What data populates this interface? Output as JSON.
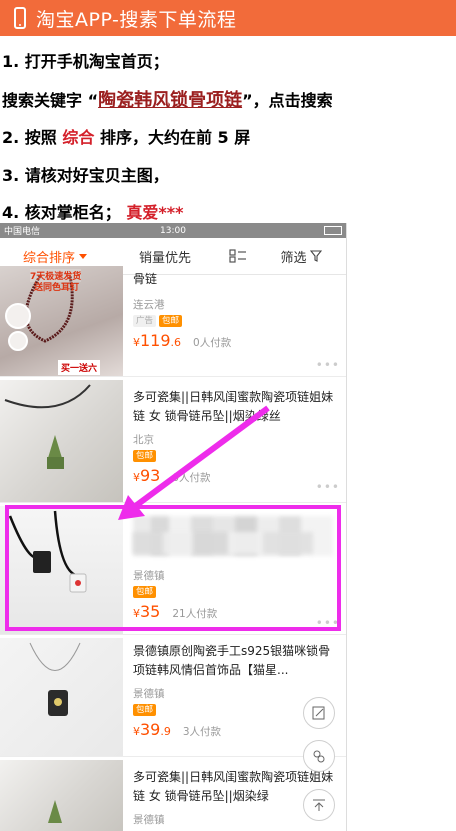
{
  "header": {
    "title": "淘宝APP-搜素下单流程"
  },
  "steps": {
    "s1": "1. 打开手机淘宝首页；",
    "s2_prefix": "搜索关键字 “",
    "s2_keyword": "陶瓷韩风锁骨项链",
    "s2_suffix": "”，点击搜索",
    "s3_prefix": "2. 按照 ",
    "s3_red": "综合",
    "s3_suffix": " 排序，大约在前 5 屏",
    "s4": "3. 请核对好宝贝主图，",
    "s5_prefix": "4. 核对掌柜名；",
    "s5_red": "真爱***"
  },
  "status_bar": {
    "carrier": "中国电信",
    "time": "13:00"
  },
  "sort_bar": {
    "comprehensive": "综合排序",
    "sales": "销量优先",
    "filter": "筛选"
  },
  "products": [
    {
      "title_line2": "骨链",
      "thumb_text1": "7天极速发货",
      "thumb_text2": "送同色耳钉",
      "thumb_promo": "买一送六",
      "location": "连云港",
      "ad_tag": "广告",
      "ship_tag": "包邮",
      "price_int": "119",
      "price_dec": ".6",
      "sold": "0人付款"
    },
    {
      "title": "多可瓷集||日韩风闺蜜款陶瓷项链姐妹链 女 锁骨链吊坠||烟染绿丝",
      "location": "北京",
      "ship_tag": "包邮",
      "price_int": "93",
      "sold": "0人付款"
    },
    {
      "location": "景德镇",
      "ship_tag": "包邮",
      "price_int": "35",
      "sold": "21人付款"
    },
    {
      "title": "景德镇原创陶瓷手工s925银猫咪锁骨项链韩风情侣首饰品【猫星...",
      "location": "景德镇",
      "ship_tag": "包邮",
      "price_int": "39",
      "price_dec": ".9",
      "sold": "3人付款"
    },
    {
      "title": "多可瓷集||日韩风闺蜜款陶瓷项链姐妹链 女 锁骨链吊坠||烟染绿",
      "location": "景德镇"
    }
  ],
  "ui": {
    "yen": "¥",
    "more": "•••",
    "arrow_color": "#EE2CEB",
    "accent": "#FF5000"
  }
}
